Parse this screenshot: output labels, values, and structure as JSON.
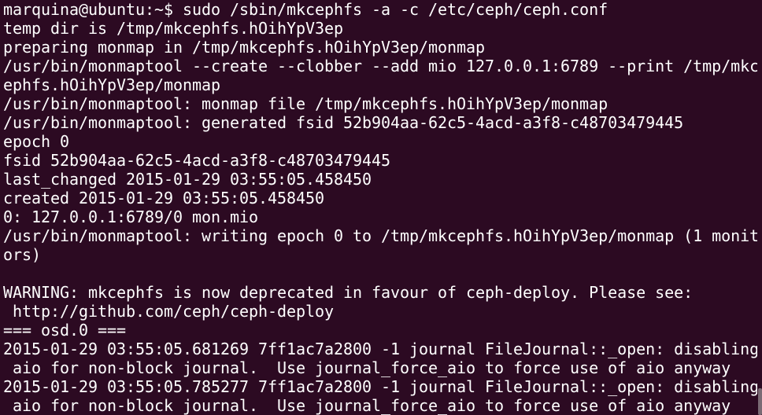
{
  "terminal": {
    "lines": [
      "marquina@ubuntu:~$ sudo /sbin/mkcephfs -a -c /etc/ceph/ceph.conf",
      "temp dir is /tmp/mkcephfs.hOihYpV3ep",
      "preparing monmap in /tmp/mkcephfs.hOihYpV3ep/monmap",
      "/usr/bin/monmaptool --create --clobber --add mio 127.0.0.1:6789 --print /tmp/mkc",
      "ephfs.hOihYpV3ep/monmap",
      "/usr/bin/monmaptool: monmap file /tmp/mkcephfs.hOihYpV3ep/monmap",
      "/usr/bin/monmaptool: generated fsid 52b904aa-62c5-4acd-a3f8-c48703479445",
      "epoch 0",
      "fsid 52b904aa-62c5-4acd-a3f8-c48703479445",
      "last_changed 2015-01-29 03:55:05.458450",
      "created 2015-01-29 03:55:05.458450",
      "0: 127.0.0.1:6789/0 mon.mio",
      "/usr/bin/monmaptool: writing epoch 0 to /tmp/mkcephfs.hOihYpV3ep/monmap (1 monit",
      "ors)",
      "",
      "WARNING: mkcephfs is now deprecated in favour of ceph-deploy. Please see:",
      " http://github.com/ceph/ceph-deploy",
      "=== osd.0 ===",
      "2015-01-29 03:55:05.681269 7ff1ac7a2800 -1 journal FileJournal::_open: disabling",
      " aio for non-block journal.  Use journal_force_aio to force use of aio anyway",
      "2015-01-29 03:55:05.785277 7ff1ac7a2800 -1 journal FileJournal::_open: disabling",
      " aio for non-block journal.  Use journal_force_aio to force use of aio anyway"
    ]
  },
  "colors": {
    "background": "#2c0a22",
    "foreground": "#ffffff",
    "scrollbar_thumb": "#7a6a74"
  }
}
